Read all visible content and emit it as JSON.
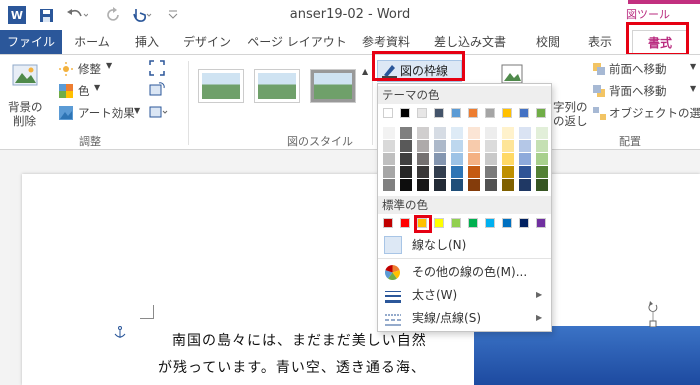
{
  "titlebar": {
    "logo": "W",
    "title": "anser19-02 - Word",
    "picture_tools": "図ツール",
    "icons": [
      "save-icon",
      "undo-icon",
      "redo-icon",
      "touch-mode-icon",
      "customize-icon"
    ]
  },
  "tabs": {
    "file": "ファイル",
    "home": "ホーム",
    "insert": "挿入",
    "design": "デザイン",
    "page_layout": "ページ レイアウト",
    "references": "参考資料",
    "mailings": "差し込み文書",
    "review": "校閲",
    "view": "表示",
    "format": "書式"
  },
  "ribbon": {
    "remove_bg_line1": "背景の",
    "remove_bg_line2": "削除",
    "corrections": "修整",
    "color": "色",
    "artistic_effects": "アート効果",
    "adjust_group": "調整",
    "picture_styles_group": "図のスタイル",
    "picture_border": "図の枠線",
    "wrap_text_line1": "字列の",
    "wrap_text_line2": "の返し",
    "bring_forward": "前面へ移動",
    "send_backward": "背面へ移動",
    "selection_pane": "オブジェクトの選択と",
    "arrange_group": "配置"
  },
  "dropdown": {
    "theme_colors": "テーマの色",
    "standard_colors": "標準の色",
    "no_outline": "線なし(N)",
    "more_colors": "その他の線の色(M)...",
    "weight": "太さ(W)",
    "dashes": "実線/点線(S)",
    "theme_row": [
      "#ffffff",
      "#000000",
      "#e7e6e6",
      "#44546a",
      "#5b9bd5",
      "#ed7d31",
      "#a5a5a5",
      "#ffc000",
      "#4472c4",
      "#70ad47"
    ],
    "theme_shades": [
      [
        "#f2f2f2",
        "#d9d9d9",
        "#bfbfbf",
        "#a6a6a6",
        "#808080"
      ],
      [
        "#7f7f7f",
        "#595959",
        "#3f3f3f",
        "#262626",
        "#0d0d0d"
      ],
      [
        "#d0cece",
        "#aeaaaa",
        "#757171",
        "#3a3838",
        "#171616"
      ],
      [
        "#d6dce4",
        "#adb9ca",
        "#8496b0",
        "#333f4f",
        "#222a35"
      ],
      [
        "#deebf6",
        "#bdd7ee",
        "#9dc3e6",
        "#2e75b5",
        "#1f4e79"
      ],
      [
        "#fbe5d5",
        "#f7cbac",
        "#f4b183",
        "#c55a11",
        "#843c0b"
      ],
      [
        "#ededed",
        "#dbdbdb",
        "#c9c9c9",
        "#7b7b7b",
        "#525252"
      ],
      [
        "#fff2cc",
        "#fee599",
        "#ffd965",
        "#bf9000",
        "#7f6000"
      ],
      [
        "#dae3f3",
        "#b4c7e7",
        "#8eaadb",
        "#2f5496",
        "#1f3864"
      ],
      [
        "#e2efd9",
        "#c5e0b3",
        "#a8d08d",
        "#538135",
        "#375623"
      ]
    ],
    "standard_row": [
      "#c00000",
      "#ff0000",
      "#ffc000",
      "#ffff00",
      "#92d050",
      "#00b050",
      "#00b0f0",
      "#0070c0",
      "#002060",
      "#7030a0"
    ],
    "selected_color": "#ffc000"
  },
  "document": {
    "line1": "南国の島々には、まだまだ美しい自然",
    "line2": "が残っています。青い空、透き通る海、"
  },
  "colors": {
    "accent": "#2b579a",
    "picture_tools": "#b92b7f",
    "highlight": "#e60012"
  }
}
